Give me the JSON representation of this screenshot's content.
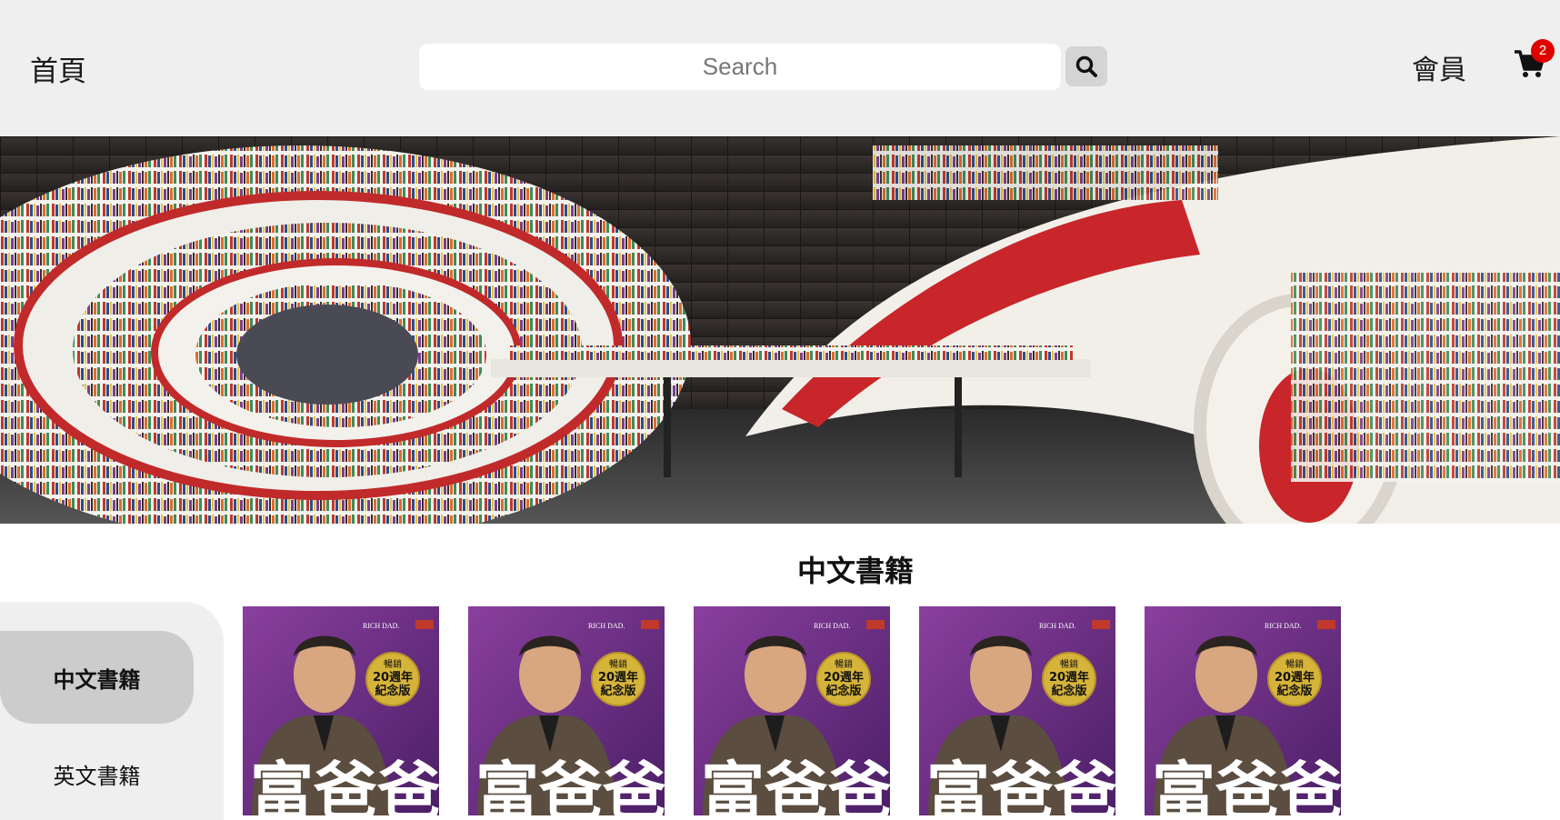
{
  "header": {
    "home_label": "首頁",
    "search_placeholder": "Search",
    "member_label": "會員",
    "cart_count": "2",
    "search_icon": "search-icon",
    "cart_icon": "cart-icon"
  },
  "banner": {
    "image": "bookstore-interior-spiral-shelves"
  },
  "section": {
    "title": "中文書籍"
  },
  "sidebar": {
    "items": [
      {
        "label": "中文書籍",
        "active": true
      },
      {
        "label": "英文書籍",
        "active": false
      }
    ]
  },
  "books": [
    {
      "brand": "RICH DAD.",
      "badge_top": "暢銷",
      "badge_mid": "20週年",
      "badge_bot": "紀念版",
      "title": "富爸爸"
    },
    {
      "brand": "RICH DAD.",
      "badge_top": "暢銷",
      "badge_mid": "20週年",
      "badge_bot": "紀念版",
      "title": "富爸爸"
    },
    {
      "brand": "RICH DAD.",
      "badge_top": "暢銷",
      "badge_mid": "20週年",
      "badge_bot": "紀念版",
      "title": "富爸爸"
    },
    {
      "brand": "RICH DAD.",
      "badge_top": "暢銷",
      "badge_mid": "20週年",
      "badge_bot": "紀念版",
      "title": "富爸爸"
    },
    {
      "brand": "RICH DAD.",
      "badge_top": "暢銷",
      "badge_mid": "20週年",
      "badge_bot": "紀念版",
      "title": "富爸爸"
    }
  ],
  "colors": {
    "header_bg": "#efefef",
    "cart_badge": "#e00000",
    "book_purple": "#6a2d86",
    "badge_gold": "#d6b43a"
  }
}
